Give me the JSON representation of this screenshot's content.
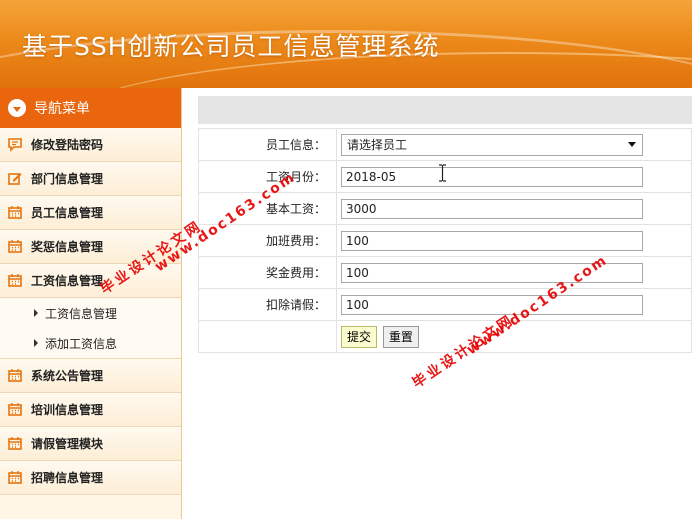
{
  "header": {
    "title": "基于SSH创新公司员工信息管理系统"
  },
  "sidebar": {
    "title": "导航菜单",
    "items": [
      {
        "label": "修改登陆密码",
        "icon": "chat-icon"
      },
      {
        "label": "部门信息管理",
        "icon": "edit-icon"
      },
      {
        "label": "员工信息管理",
        "icon": "calendar-icon"
      },
      {
        "label": "奖惩信息管理",
        "icon": "calendar-icon"
      },
      {
        "label": "工资信息管理",
        "icon": "calendar-icon"
      },
      {
        "label": "系统公告管理",
        "icon": "calendar-icon"
      },
      {
        "label": "培训信息管理",
        "icon": "calendar-icon"
      },
      {
        "label": "请假管理模块",
        "icon": "calendar-icon"
      },
      {
        "label": "招聘信息管理",
        "icon": "calendar-icon"
      }
    ],
    "subitems": [
      {
        "label": "工资信息管理"
      },
      {
        "label": "添加工资信息"
      }
    ]
  },
  "form": {
    "employee": {
      "label": "员工信息：",
      "value": "请选择员工"
    },
    "month": {
      "label": "工资月份：",
      "value": "2018-05"
    },
    "base": {
      "label": "基本工资：",
      "value": "3000"
    },
    "overtime": {
      "label": "加班费用：",
      "value": "100"
    },
    "bonus": {
      "label": "奖金费用：",
      "value": "100"
    },
    "leave": {
      "label": "扣除请假：",
      "value": "100"
    },
    "submit_label": "提交",
    "reset_label": "重置"
  },
  "watermark": {
    "line1": "毕业设计论文网",
    "line2": "www.doc163.com"
  },
  "colors": {
    "header": "#ec8a1a",
    "nav_head": "#e9660f",
    "icon": "#e6740f",
    "watermark": "#e60000"
  }
}
